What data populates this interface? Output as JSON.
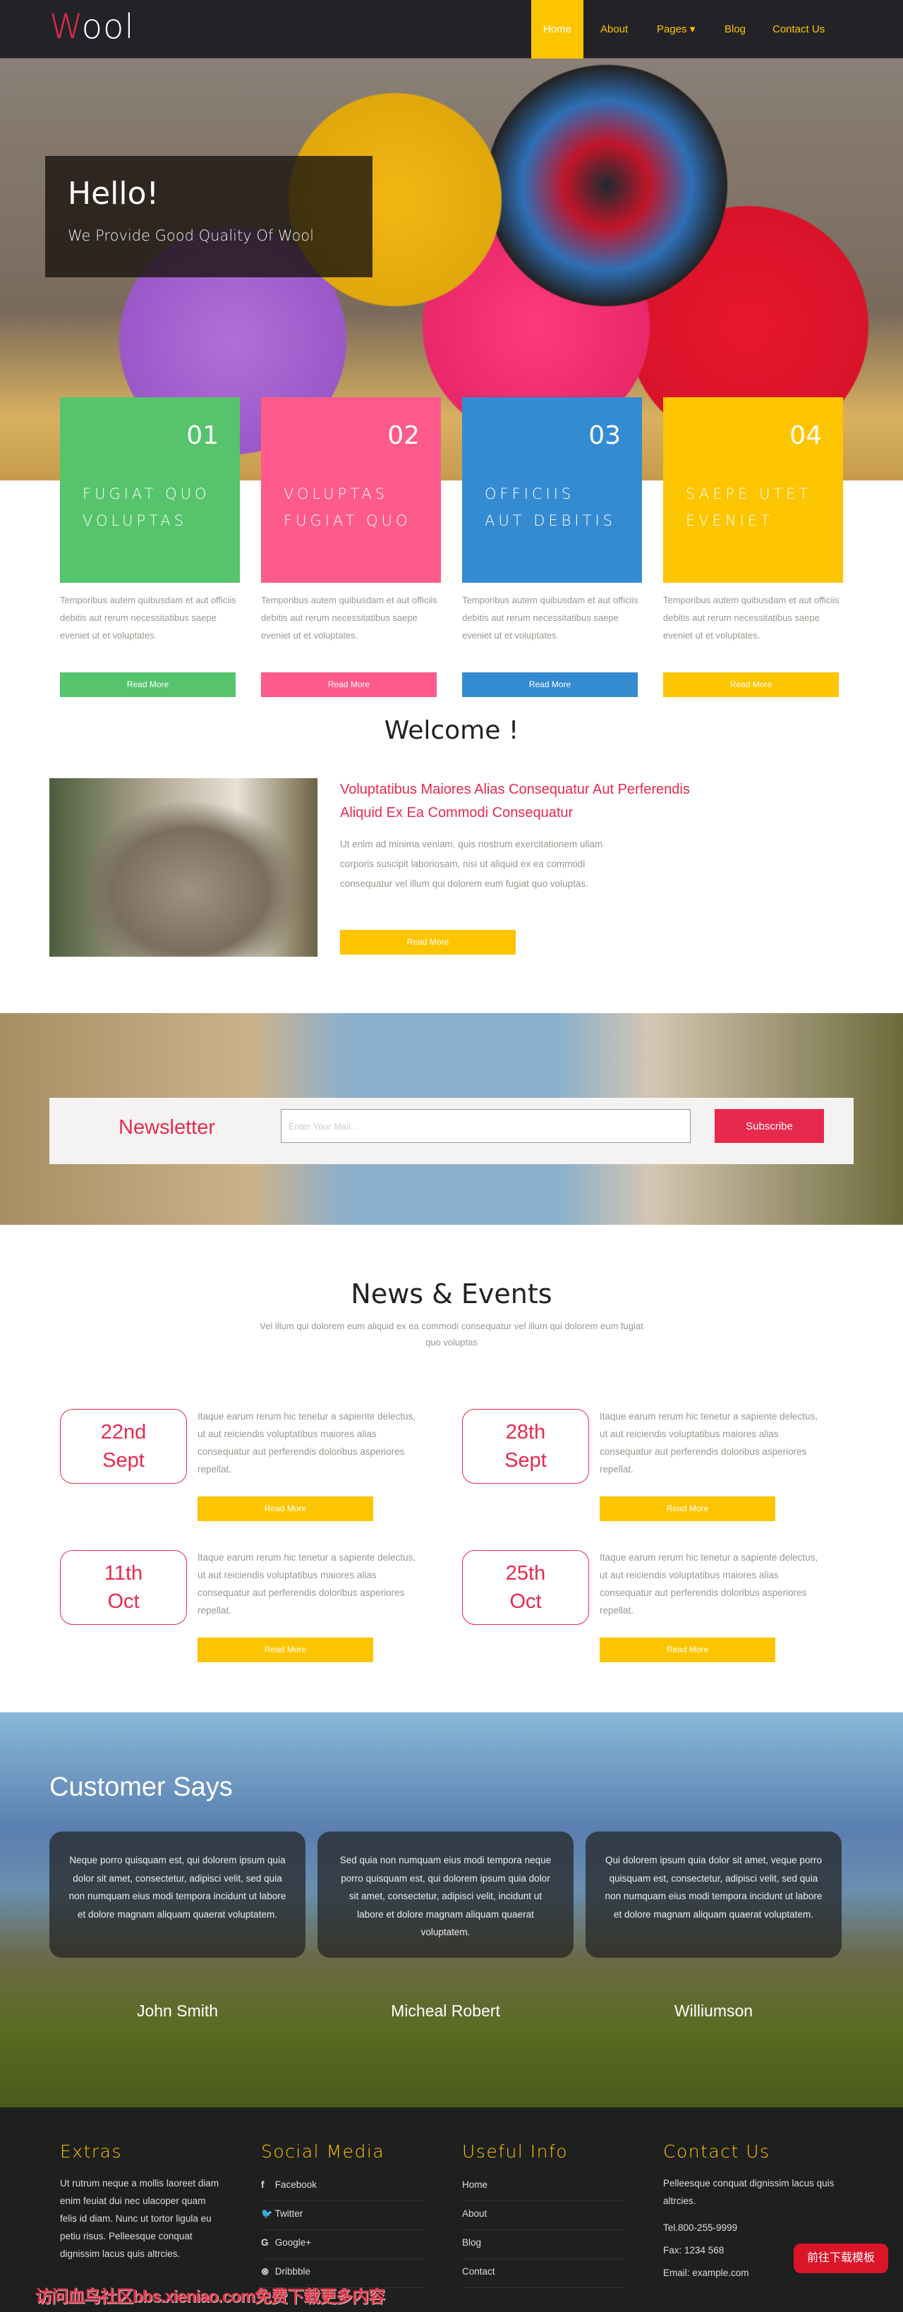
{
  "nav": {
    "logo_first": "W",
    "logo_rest": "ool",
    "items": [
      {
        "label": "Home"
      },
      {
        "label": "About"
      },
      {
        "label": "Pages ▾"
      },
      {
        "label": "Blog"
      },
      {
        "label": "Contact Us"
      }
    ]
  },
  "hero": {
    "title": "Hello!",
    "subtitle": "We Provide Good Quality Of Wool"
  },
  "features": [
    {
      "num": "01",
      "label": "FUGIAT QUO VOLUPTAS",
      "color": "#55c46c",
      "text": "Temporibus autem quibusdam et aut officiis debitis aut rerum necessitatibus saepe eveniet ut et voluptates.",
      "button": "Read More"
    },
    {
      "num": "02",
      "label": "VOLUPTAS FUGIAT QUO",
      "color": "#ff5a8c",
      "text": "Temporibus autem quibusdam et aut officiis debitis aut rerum necessitatibus saepe eveniet ut et voluptates.",
      "button": "Read More"
    },
    {
      "num": "03",
      "label": "OFFICIIS AUT DEBITIS",
      "color": "#358bd2",
      "text": "Temporibus autem quibusdam et aut officiis debitis aut rerum necessitatibus saepe eveniet ut et voluptates.",
      "button": "Read More"
    },
    {
      "num": "04",
      "label": "SAEPE UTET EVENIET",
      "color": "#fdc500",
      "text": "Temporibus autem quibusdam et aut officiis debitis aut rerum necessitatibus saepe eveniet ut et voluptates.",
      "button": "Read More"
    }
  ],
  "welcome": {
    "title": "Welcome !",
    "heading": "Voluptatibus Maiores Alias Consequatur Aut Perferendis Aliquid Ex Ea Commodi Consequatur",
    "text": "Ut enim ad minima veniam, quis nostrum exercitationem ullam corporis suscipit laboriosam, nisi ut aliquid ex ea commodi consequatur vel illum qui dolorem eum fugiat quo voluptas.",
    "button": "Read More"
  },
  "newsletter": {
    "label": "Newsletter",
    "placeholder": "Enter Your Mail...",
    "button": "Subscribe"
  },
  "news": {
    "title": "News & Events",
    "subtitle": "Vel illum qui dolorem eum aliquid ex ea commodi consequatur vel illum qui dolorem eum fugiat quo voluptas",
    "items": [
      {
        "day": "22nd",
        "month": "Sept",
        "text": "Itaque earum rerum hic tenetur a sapiente delectus, ut aut reiciendis voluptatibus maiores alias consequatur aut perferendis doloribus asperiores repellat.",
        "button": "Read More"
      },
      {
        "day": "28th",
        "month": "Sept",
        "text": "Itaque earum rerum hic tenetur a sapiente delectus, ut aut reiciendis voluptatibus maiores alias consequatur aut perferendis doloribus asperiores repellat.",
        "button": "Read More"
      },
      {
        "day": "11th",
        "month": "Oct",
        "text": "Itaque earum rerum hic tenetur a sapiente delectus, ut aut reiciendis voluptatibus maiores alias consequatur aut perferendis doloribus asperiores repellat.",
        "button": "Read More"
      },
      {
        "day": "25th",
        "month": "Oct",
        "text": "Itaque earum rerum hic tenetur a sapiente delectus, ut aut reiciendis voluptatibus maiores alias consequatur aut perferendis doloribus asperiores repellat.",
        "button": "Read More"
      }
    ]
  },
  "testimonials": {
    "title": "Customer Says",
    "items": [
      {
        "text": "Neque porro quisquam est, qui dolorem ipsum quia dolor sit amet, consectetur, adipisci velit, sed quia non numquam eius modi tempora incidunt ut labore et dolore magnam aliquam quaerat voluptatem.",
        "name": "John Smith"
      },
      {
        "text": "Sed quia non numquam eius modi tempora neque porro quisquam est, qui dolorem ipsum quia dolor sit amet, consectetur, adipisci velit, incidunt ut labore et dolore magnam aliquam quaerat voluptatem.",
        "name": "Micheal Robert"
      },
      {
        "text": "Qui dolorem ipsum quia dolor sit amet, veque porro quisquam est, consectetur, adipisci velit, sed quia non numquam eius modi tempora incidunt ut labore et dolore magnam aliquam quaerat voluptatem.",
        "name": "Williumson"
      }
    ]
  },
  "footer": {
    "extras": {
      "title": "Extras",
      "text": "Ut rutrum neque a mollis laoreet diam enim feuiat dui nec ulacoper quam felis id diam. Nunc ut tortor ligula eu petiu risus. Pelleesque conquat dignissim lacus quis altrcies."
    },
    "social": {
      "title": "Social Media",
      "items": [
        {
          "icon": "facebook-icon",
          "glyph": "f",
          "label": "Facebook"
        },
        {
          "icon": "twitter-icon",
          "glyph": "🐦",
          "label": "Twitter"
        },
        {
          "icon": "google-plus-icon",
          "glyph": "G",
          "label": "Google+"
        },
        {
          "icon": "dribbble-icon",
          "glyph": "⊛",
          "label": "Dribbble"
        }
      ]
    },
    "useful": {
      "title": "Useful Info",
      "items": [
        {
          "label": "Home"
        },
        {
          "label": "About"
        },
        {
          "label": "Blog"
        },
        {
          "label": "Contact"
        }
      ]
    },
    "contact": {
      "title": "Contact Us",
      "address": "Pelleesque conquat dignissim lacus quis altrcies.",
      "tel": "Tel.800-255-9999",
      "fax": "Fax: 1234 568",
      "email": "Email: example.com"
    }
  },
  "watermark": "访问血鸟社区bbs.xieniao.com免费下载更多内容",
  "download_button": "前往下载模板"
}
